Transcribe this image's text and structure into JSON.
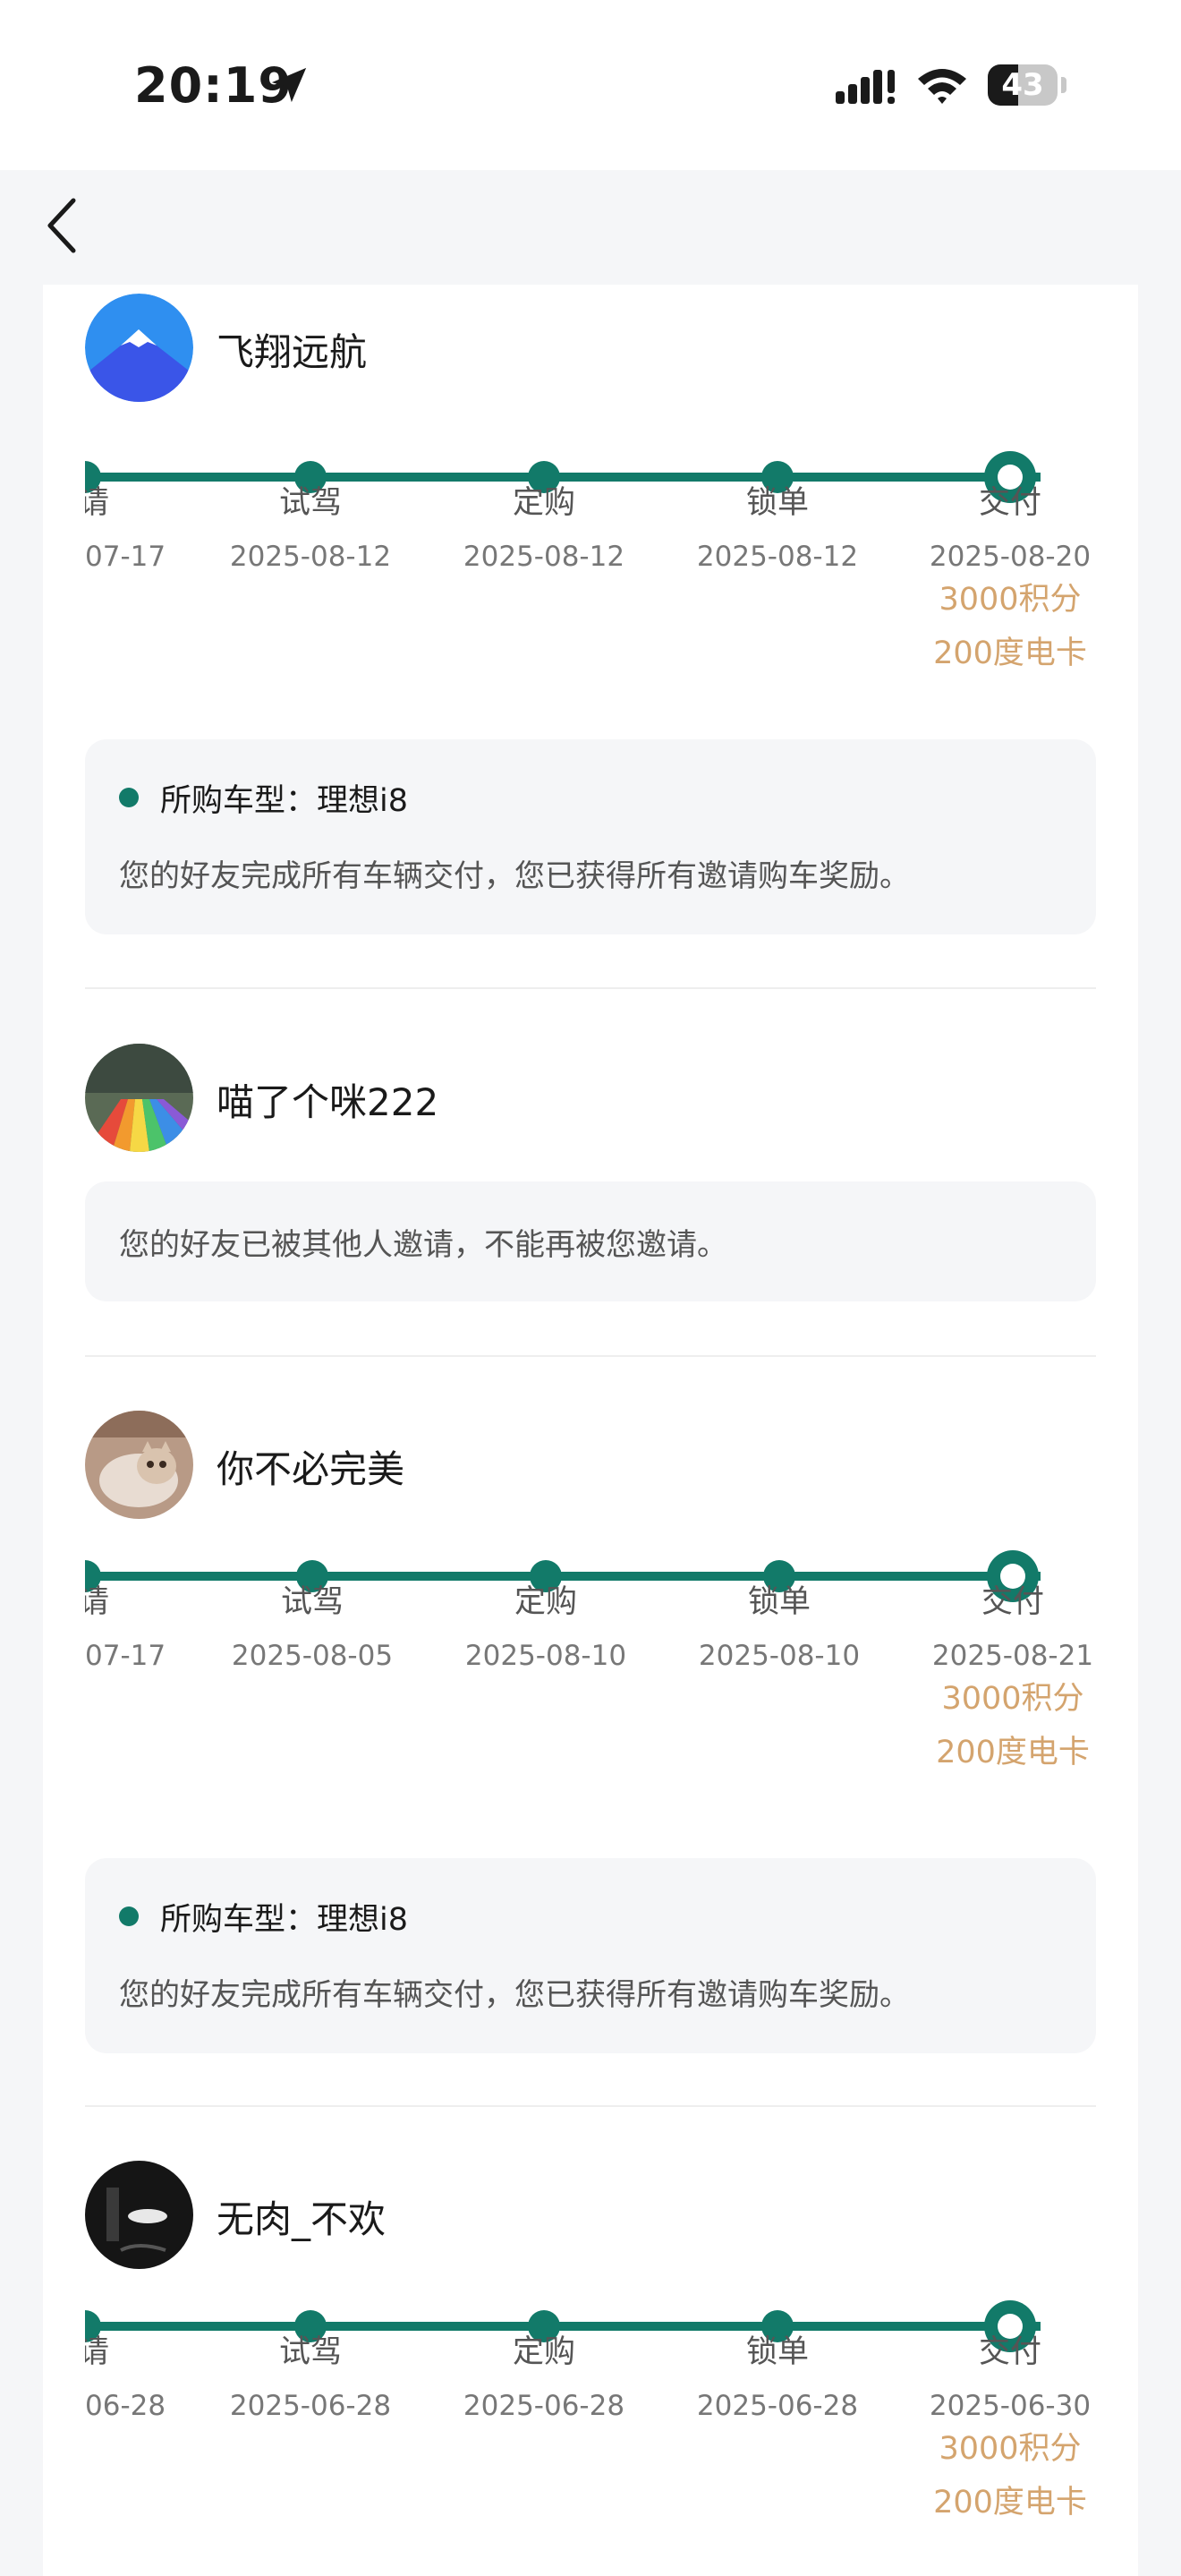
{
  "status_bar": {
    "time": "20:19",
    "battery": "43",
    "battery_level_percent": 43,
    "icons": [
      "location-arrow-icon",
      "cellular-signal-icon",
      "wifi-icon",
      "battery-icon"
    ]
  },
  "nav": {
    "back_icon": "chevron-left-icon"
  },
  "colors": {
    "accent": "#127a69",
    "reward": "#d4a46e",
    "panel": "#f5f6f8"
  },
  "invites": [
    {
      "name": "飞翔远航",
      "avatar": "mountain-avatar",
      "steps": [
        {
          "label": "请",
          "date": "07-17"
        },
        {
          "label": "试驾",
          "date": "2025-08-12"
        },
        {
          "label": "定购",
          "date": "2025-08-12"
        },
        {
          "label": "锁单",
          "date": "2025-08-12"
        },
        {
          "label": "交付",
          "date": "2025-08-20"
        }
      ],
      "rewards": [
        "3000积分",
        "200度电卡"
      ],
      "car_model": "所购车型：理想i8",
      "message": "您的好友完成所有车辆交付，您已获得所有邀请购车奖励。"
    },
    {
      "name": "喵了个咪222",
      "avatar": "rainbow-slide-avatar",
      "message": "您的好友已被其他人邀请，不能再被您邀请。"
    },
    {
      "name": "你不必完美",
      "avatar": "cat-avatar",
      "steps": [
        {
          "label": "请",
          "date": "07-17"
        },
        {
          "label": "试驾",
          "date": "2025-08-05"
        },
        {
          "label": "定购",
          "date": "2025-08-10"
        },
        {
          "label": "锁单",
          "date": "2025-08-10"
        },
        {
          "label": "交付",
          "date": "2025-08-21"
        }
      ],
      "rewards": [
        "3000积分",
        "200度电卡"
      ],
      "car_model": "所购车型：理想i8",
      "message": "您的好友完成所有车辆交付，您已获得所有邀请购车奖励。"
    },
    {
      "name": "无肉_不欢",
      "avatar": "dark-photo-avatar",
      "steps": [
        {
          "label": "请",
          "date": "06-28"
        },
        {
          "label": "试驾",
          "date": "2025-06-28"
        },
        {
          "label": "定购",
          "date": "2025-06-28"
        },
        {
          "label": "锁单",
          "date": "2025-06-28"
        },
        {
          "label": "交付",
          "date": "2025-06-30"
        }
      ],
      "rewards": [
        "3000积分",
        "200度电卡"
      ]
    }
  ]
}
